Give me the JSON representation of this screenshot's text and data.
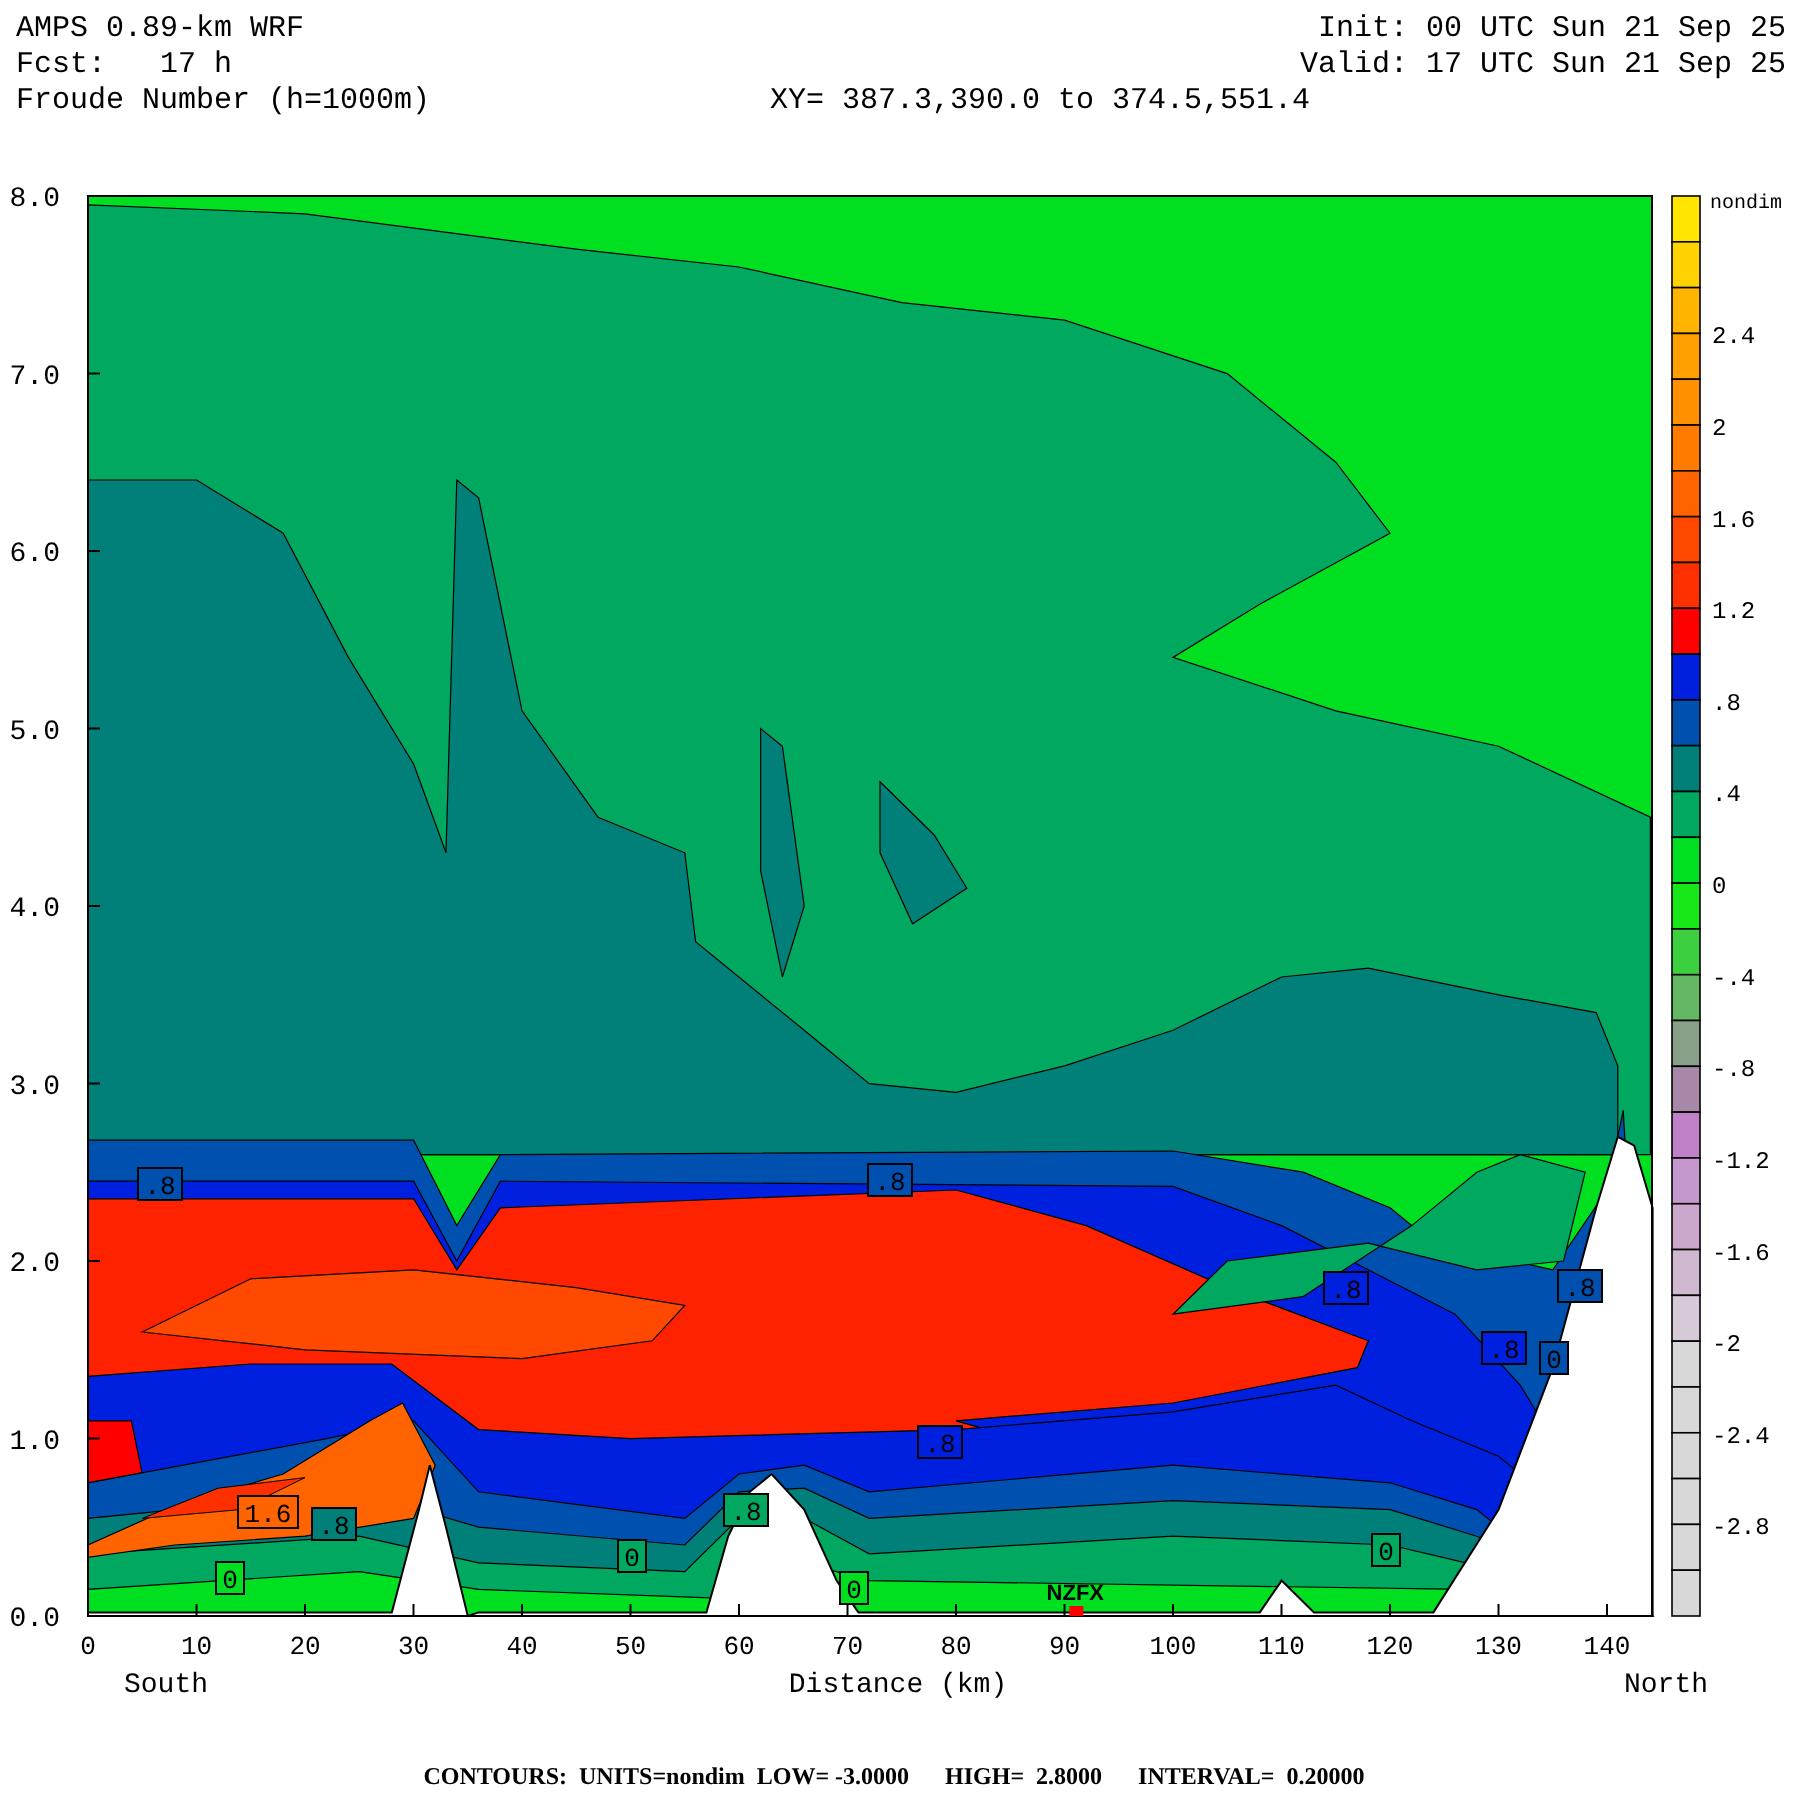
{
  "header": {
    "model": "AMPS 0.89-km WRF",
    "forecast": "Fcst:   17 h",
    "field": "Froude Number (h=1000m)",
    "init": "Init: 00 UTC Sun 21 Sep 25",
    "valid": "Valid: 17 UTC Sun 21 Sep 25",
    "cross_section": "XY= 387.3,390.0 to 374.5,551.4"
  },
  "plot": {
    "y_ticks": [
      "8.0",
      "7.0",
      "6.0",
      "5.0",
      "4.0",
      "3.0",
      "2.0",
      "1.0",
      "0.0"
    ],
    "x_ticks": [
      "0",
      "10",
      "20",
      "30",
      "40",
      "50",
      "60",
      "70",
      "80",
      "90",
      "100",
      "110",
      "120",
      "130",
      "140"
    ],
    "left_end": "South",
    "x_label": "Distance (km)",
    "right_end": "North",
    "contour_labels": [
      ".8",
      ".8",
      ".8",
      ".8",
      ".8",
      ".8",
      ".8",
      ".8",
      "1.6",
      "0",
      "0",
      "0",
      "0",
      "0"
    ],
    "station": "NZFX"
  },
  "colorbar": {
    "units": "nondim",
    "boxes": [
      {
        "color": "#ffe600"
      },
      {
        "color": "#ffd200"
      },
      {
        "color": "#ffb400"
      },
      {
        "color": "#ffa000",
        "label": "2.4"
      },
      {
        "color": "#ff9000"
      },
      {
        "color": "#ff7c00",
        "label": "2"
      },
      {
        "color": "#ff6400"
      },
      {
        "color": "#ff4800",
        "label": "1.6"
      },
      {
        "color": "#ff3000"
      },
      {
        "color": "#ff0000",
        "label": "1.2"
      },
      {
        "color": "#0020e0"
      },
      {
        "color": "#0050b0",
        "label": ".8"
      },
      {
        "color": "#008078"
      },
      {
        "color": "#00a860",
        "label": ".4"
      },
      {
        "color": "#00e020"
      },
      {
        "color": "#18e818",
        "label": "0"
      },
      {
        "color": "#3cd040"
      },
      {
        "color": "#64b864",
        "label": "-.4"
      },
      {
        "color": "#88a088"
      },
      {
        "color": "#a888a8",
        "label": "-.8"
      },
      {
        "color": "#c080c8"
      },
      {
        "color": "#c498cc",
        "label": "-1.2"
      },
      {
        "color": "#caa8cc"
      },
      {
        "color": "#d0b8d0",
        "label": "-1.6"
      },
      {
        "color": "#d6cad6"
      },
      {
        "color": "#d8d8d8",
        "label": "-2"
      },
      {
        "color": "#d8d8d8"
      },
      {
        "color": "#d8d8d8",
        "label": "-2.4"
      },
      {
        "color": "#d8d8d8"
      },
      {
        "color": "#d8d8d8",
        "label": "-2.8"
      },
      {
        "color": "#d8d8d8"
      }
    ]
  },
  "footer": "CONTOURS:  UNITS=nondim  LOW= -3.0000      HIGH=  2.8000      INTERVAL=  0.20000"
}
